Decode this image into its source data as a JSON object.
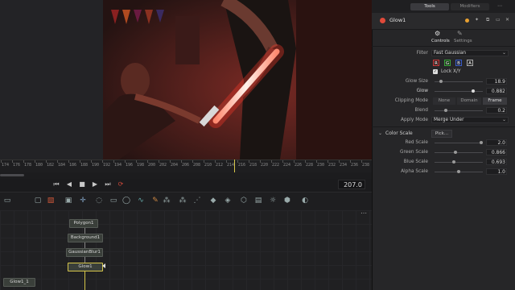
{
  "top_tabs": {
    "tools": "Tools",
    "modifiers": "Modifiers"
  },
  "inspector": {
    "node_title": "Glow1",
    "tabs": {
      "controls": "Controls",
      "settings": "Settings"
    },
    "filter": {
      "label": "Filter",
      "value": "Fast Gaussian"
    },
    "channels": [
      "R",
      "G",
      "B",
      "A"
    ],
    "lock_xy": "Lock X/Y",
    "glow_size": {
      "label": "Glow Size",
      "value": "18.9"
    },
    "glow": {
      "label": "Glow",
      "value": "0.882"
    },
    "clipping_mode": {
      "label": "Clipping Mode",
      "options": [
        "None",
        "Domain",
        "Frame"
      ],
      "selected": "Frame"
    },
    "blend": {
      "label": "Blend",
      "value": "0.2"
    },
    "apply_mode": {
      "label": "Apply Mode",
      "value": "Merge Under"
    },
    "color_scale": {
      "header": "Color Scale",
      "pick_label": "Pick...",
      "red": {
        "label": "Red Scale",
        "value": "2.0"
      },
      "green": {
        "label": "Green Scale",
        "value": "0.866"
      },
      "blue": {
        "label": "Blue Scale",
        "value": "0.693"
      },
      "alpha": {
        "label": "Alpha Scale",
        "value": "1.0"
      }
    }
  },
  "timeline": {
    "ticks": [
      "174",
      "176",
      "178",
      "180",
      "182",
      "184",
      "186",
      "188",
      "190",
      "192",
      "194",
      "196",
      "198",
      "200",
      "202",
      "204",
      "206",
      "208",
      "210",
      "212",
      "214",
      "216",
      "218",
      "220",
      "222",
      "224",
      "226",
      "228",
      "230",
      "232",
      "234",
      "236",
      "238"
    ],
    "current_frame": "207.0"
  },
  "nodes": [
    "Polygon1",
    "Background1",
    "GaussianBlur1",
    "Glow1",
    "Glow1_1"
  ],
  "colors": {
    "accent": "#d6c64a",
    "red_channel": "#c43a3a",
    "green_channel": "#3aa23a",
    "blue_channel": "#3a5cc4"
  }
}
